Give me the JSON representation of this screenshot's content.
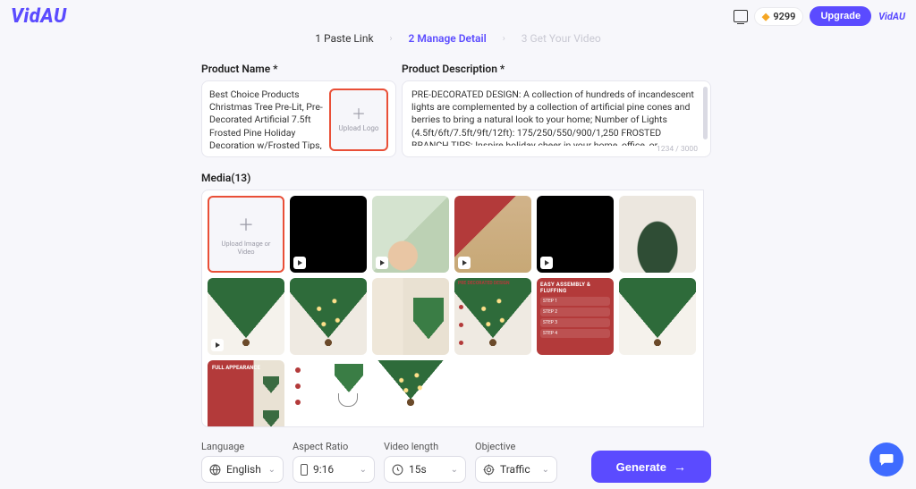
{
  "header": {
    "logo_text": "VidAU",
    "credits": "9299",
    "upgrade_label": "Upgrade",
    "brand_chip": "VidAU"
  },
  "stepper": {
    "step1": "1 Paste Link",
    "step2": "2 Manage Detail",
    "step3": "3 Get Your Video"
  },
  "form": {
    "product_name_label": "Product Name *",
    "product_name_value": " Best Choice Products Christmas Tree Pre-Lit, Pre-Decorated Artificial 7.5ft Frosted Pine Holiday Decoration w/Frosted Tips, Pine Cones, Berries",
    "upload_logo_label": "Upload Logo",
    "product_desc_label": "Product Description *",
    "product_desc_value": "PRE-DECORATED DESIGN: A collection of hundreds of incandescent lights are complemented by a collection of artificial pine cones and berries to bring a natural look to your home; Number of Lights (4.5ft/6ft/7.5ft/9ft/12ft): 175/250/550/900/1,250\nFROSTED BRANCH TIPS: Inspire holiday cheer in your home, office, or",
    "char_count": "1234 / 3000"
  },
  "media": {
    "label": "Media(13)",
    "upload_tile_label": "Upload Image or Video",
    "count": 13,
    "red_card_header": "EASY ASSEMBLY & FLUFFING",
    "red_card_steps": [
      "STEP 1",
      "STEP 2",
      "STEP 3",
      "STEP 4"
    ],
    "red2_header": "FULL APPEARANCE",
    "info_header": "PRE DECORATED DESIGN"
  },
  "controls": {
    "language_label": "Language",
    "language_value": "English",
    "aspect_label": "Aspect Ratio",
    "aspect_value": "9:16",
    "length_label": "Video length",
    "length_value": "15s",
    "objective_label": "Objective",
    "objective_value": "Traffic",
    "generate_label": "Generate"
  }
}
